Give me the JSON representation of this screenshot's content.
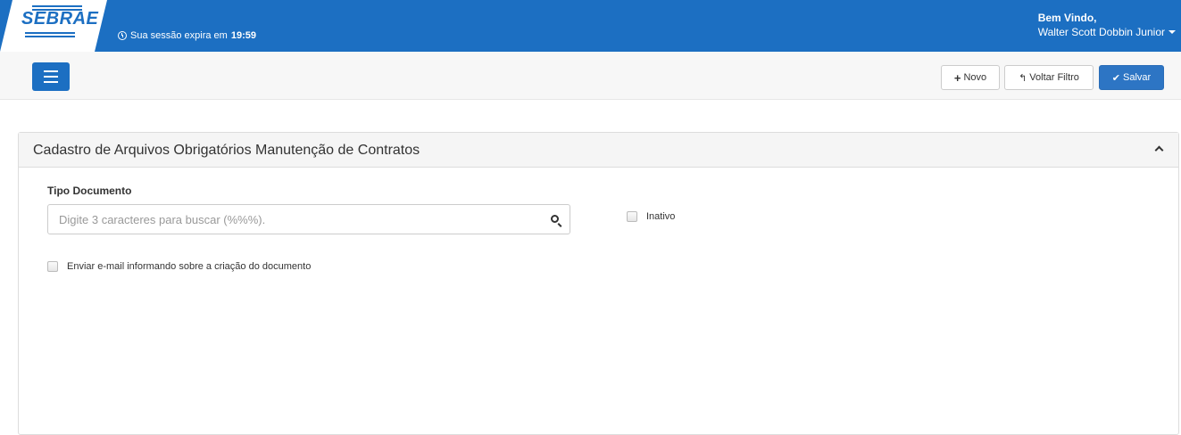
{
  "header": {
    "logo_text": "SEBRAE",
    "session_prefix": "Sua sessão expira em",
    "session_time": "19:59",
    "welcome": "Bem Vindo,",
    "user_name": "Walter Scott Dobbin Junior"
  },
  "toolbar": {
    "novo_label": "Novo",
    "voltar_label": "Voltar Filtro",
    "salvar_label": "Salvar"
  },
  "panel": {
    "title": "Cadastro de Arquivos Obrigatórios Manutenção de Contratos",
    "tipo_documento_label": "Tipo Documento",
    "search_placeholder": "Digite 3 caracteres para buscar (%%%).",
    "inativo_label": "Inativo",
    "email_label": "Enviar e-mail informando sobre a criação do documento"
  },
  "colors": {
    "brand": "#1c6fc2",
    "primary_button": "#2d75c4"
  }
}
